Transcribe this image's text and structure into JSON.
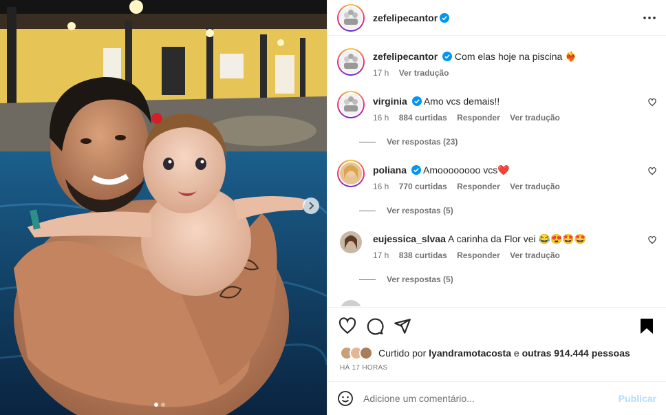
{
  "post": {
    "author": "zefelipecantor",
    "author_verified": true,
    "carousel": {
      "dots": 2,
      "active_dot": 1
    },
    "more_icon": "more-horizontal-icon"
  },
  "caption": {
    "username": "zefelipecantor",
    "text": "Com elas hoje na piscina",
    "emoji": "❤️‍🔥",
    "time": "17 h",
    "translate": "Ver tradução"
  },
  "comments": [
    {
      "username": "virginia",
      "verified": true,
      "text": "Amo vcs demais!!",
      "time": "16 h",
      "likes": "884 curtidas",
      "reply": "Responder",
      "translate": "Ver tradução",
      "view_replies": "Ver respostas (23)"
    },
    {
      "username": "poliana",
      "verified": true,
      "text": "Amoooooooo vcs❤️",
      "time": "16 h",
      "likes": "770 curtidas",
      "reply": "Responder",
      "translate": "Ver tradução",
      "view_replies": "Ver respostas (5)"
    },
    {
      "username": "eujessica_slvaa",
      "verified": false,
      "text": "A carinha da Flor vei 😂😍🤩🤩",
      "time": "17 h",
      "likes": "838 curtidas",
      "reply": "Responder",
      "translate": "Ver tradução",
      "view_replies": "Ver respostas (5)"
    }
  ],
  "actions": {
    "like_icon": "heart-icon",
    "comment_icon": "comment-icon",
    "share_icon": "send-icon",
    "save_icon": "bookmark-icon"
  },
  "likes": {
    "prefix": "Curtido por",
    "user": "lyandramotacosta",
    "middle": "e",
    "others": "outras 914.444 pessoas"
  },
  "posted_time": "HÁ 17 HORAS",
  "composer": {
    "emoji_icon": "smiley-icon",
    "placeholder": "Adicione um comentário...",
    "publish": "Publicar"
  },
  "colors": {
    "verified": "#0095f6",
    "publish_disabled": "#b3dbff",
    "secondary_text": "#737373"
  }
}
